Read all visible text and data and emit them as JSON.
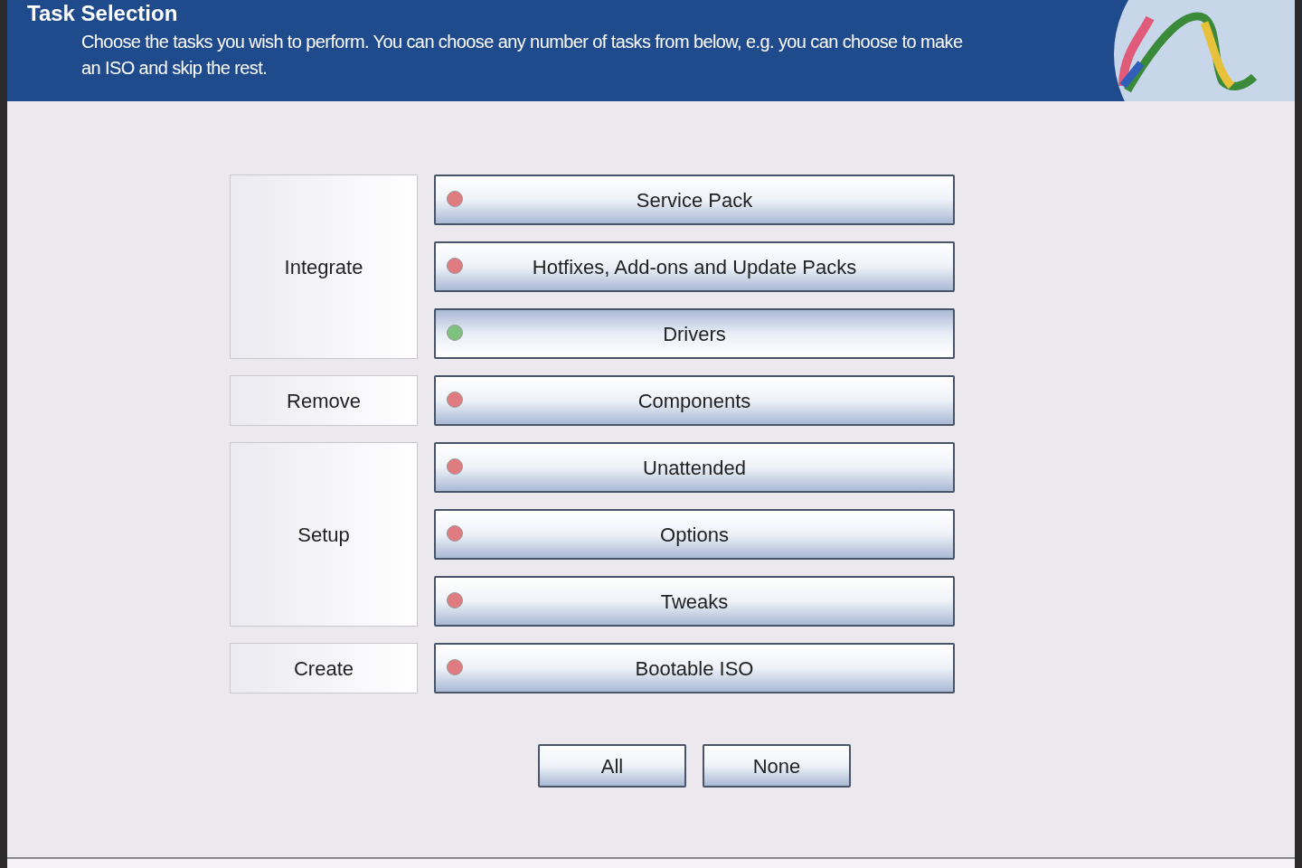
{
  "header": {
    "title": "Task Selection",
    "description": "Choose the tasks you wish to perform. You can choose any number of tasks from below, e.g. you can choose to make an ISO and skip the rest."
  },
  "groups": [
    {
      "label": "Integrate",
      "tasks": [
        {
          "label": "Service Pack",
          "selected": false
        },
        {
          "label": "Hotfixes, Add-ons and Update Packs",
          "selected": false
        },
        {
          "label": "Drivers",
          "selected": true
        }
      ]
    },
    {
      "label": "Remove",
      "tasks": [
        {
          "label": "Components",
          "selected": false
        }
      ]
    },
    {
      "label": "Setup",
      "tasks": [
        {
          "label": "Unattended",
          "selected": false
        },
        {
          "label": "Options",
          "selected": false
        },
        {
          "label": "Tweaks",
          "selected": false
        }
      ]
    },
    {
      "label": "Create",
      "tasks": [
        {
          "label": "Bootable ISO",
          "selected": false
        }
      ]
    }
  ],
  "buttons": [
    "All",
    "None"
  ]
}
